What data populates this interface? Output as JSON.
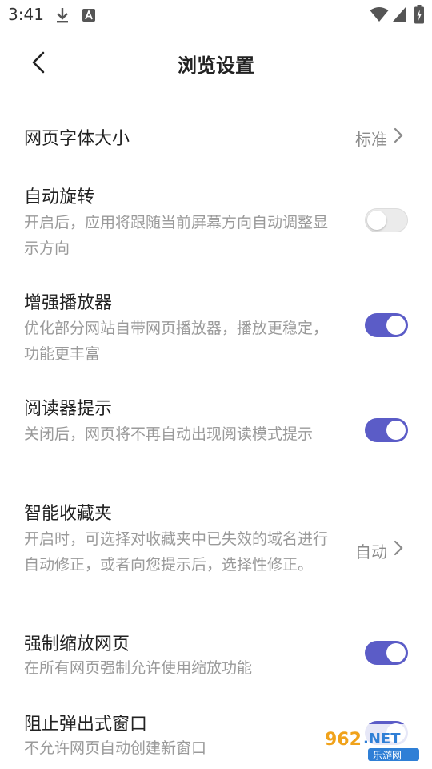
{
  "status_bar": {
    "time": "3:41"
  },
  "header": {
    "title": "浏览设置"
  },
  "settings": {
    "font_size": {
      "title": "网页字体大小",
      "value": "标准"
    },
    "auto_rotate": {
      "title": "自动旋转",
      "desc": "开启后，应用将跟随当前屏幕方向自动调整显示方向",
      "enabled": false
    },
    "enhanced_player": {
      "title": "增强播放器",
      "desc": "优化部分网站自带网页播放器，播放更稳定，功能更丰富",
      "enabled": true
    },
    "reader_hint": {
      "title": "阅读器提示",
      "desc": "关闭后，网页将不再自动出现阅读模式提示",
      "enabled": true
    },
    "smart_favorites": {
      "title": "智能收藏夹",
      "desc": "开启时，可选择对收藏夹中已失效的域名进行自动修正，或者向您提示后，选择性修正。",
      "value": "自动"
    },
    "force_zoom": {
      "title": "强制缩放网页",
      "desc": "在所有网页强制允许使用缩放功能",
      "enabled": true
    },
    "block_popups": {
      "title": "阻止弹出式窗口",
      "desc": "不允许网页自动创建新窗口",
      "enabled": true
    }
  },
  "watermark": {
    "logo_text": "962.NET",
    "sub_text": "乐游网"
  },
  "colors": {
    "accent": "#5b5cc7",
    "toggle_off": "#ebebeb",
    "desc_text": "#9a9a9a"
  }
}
